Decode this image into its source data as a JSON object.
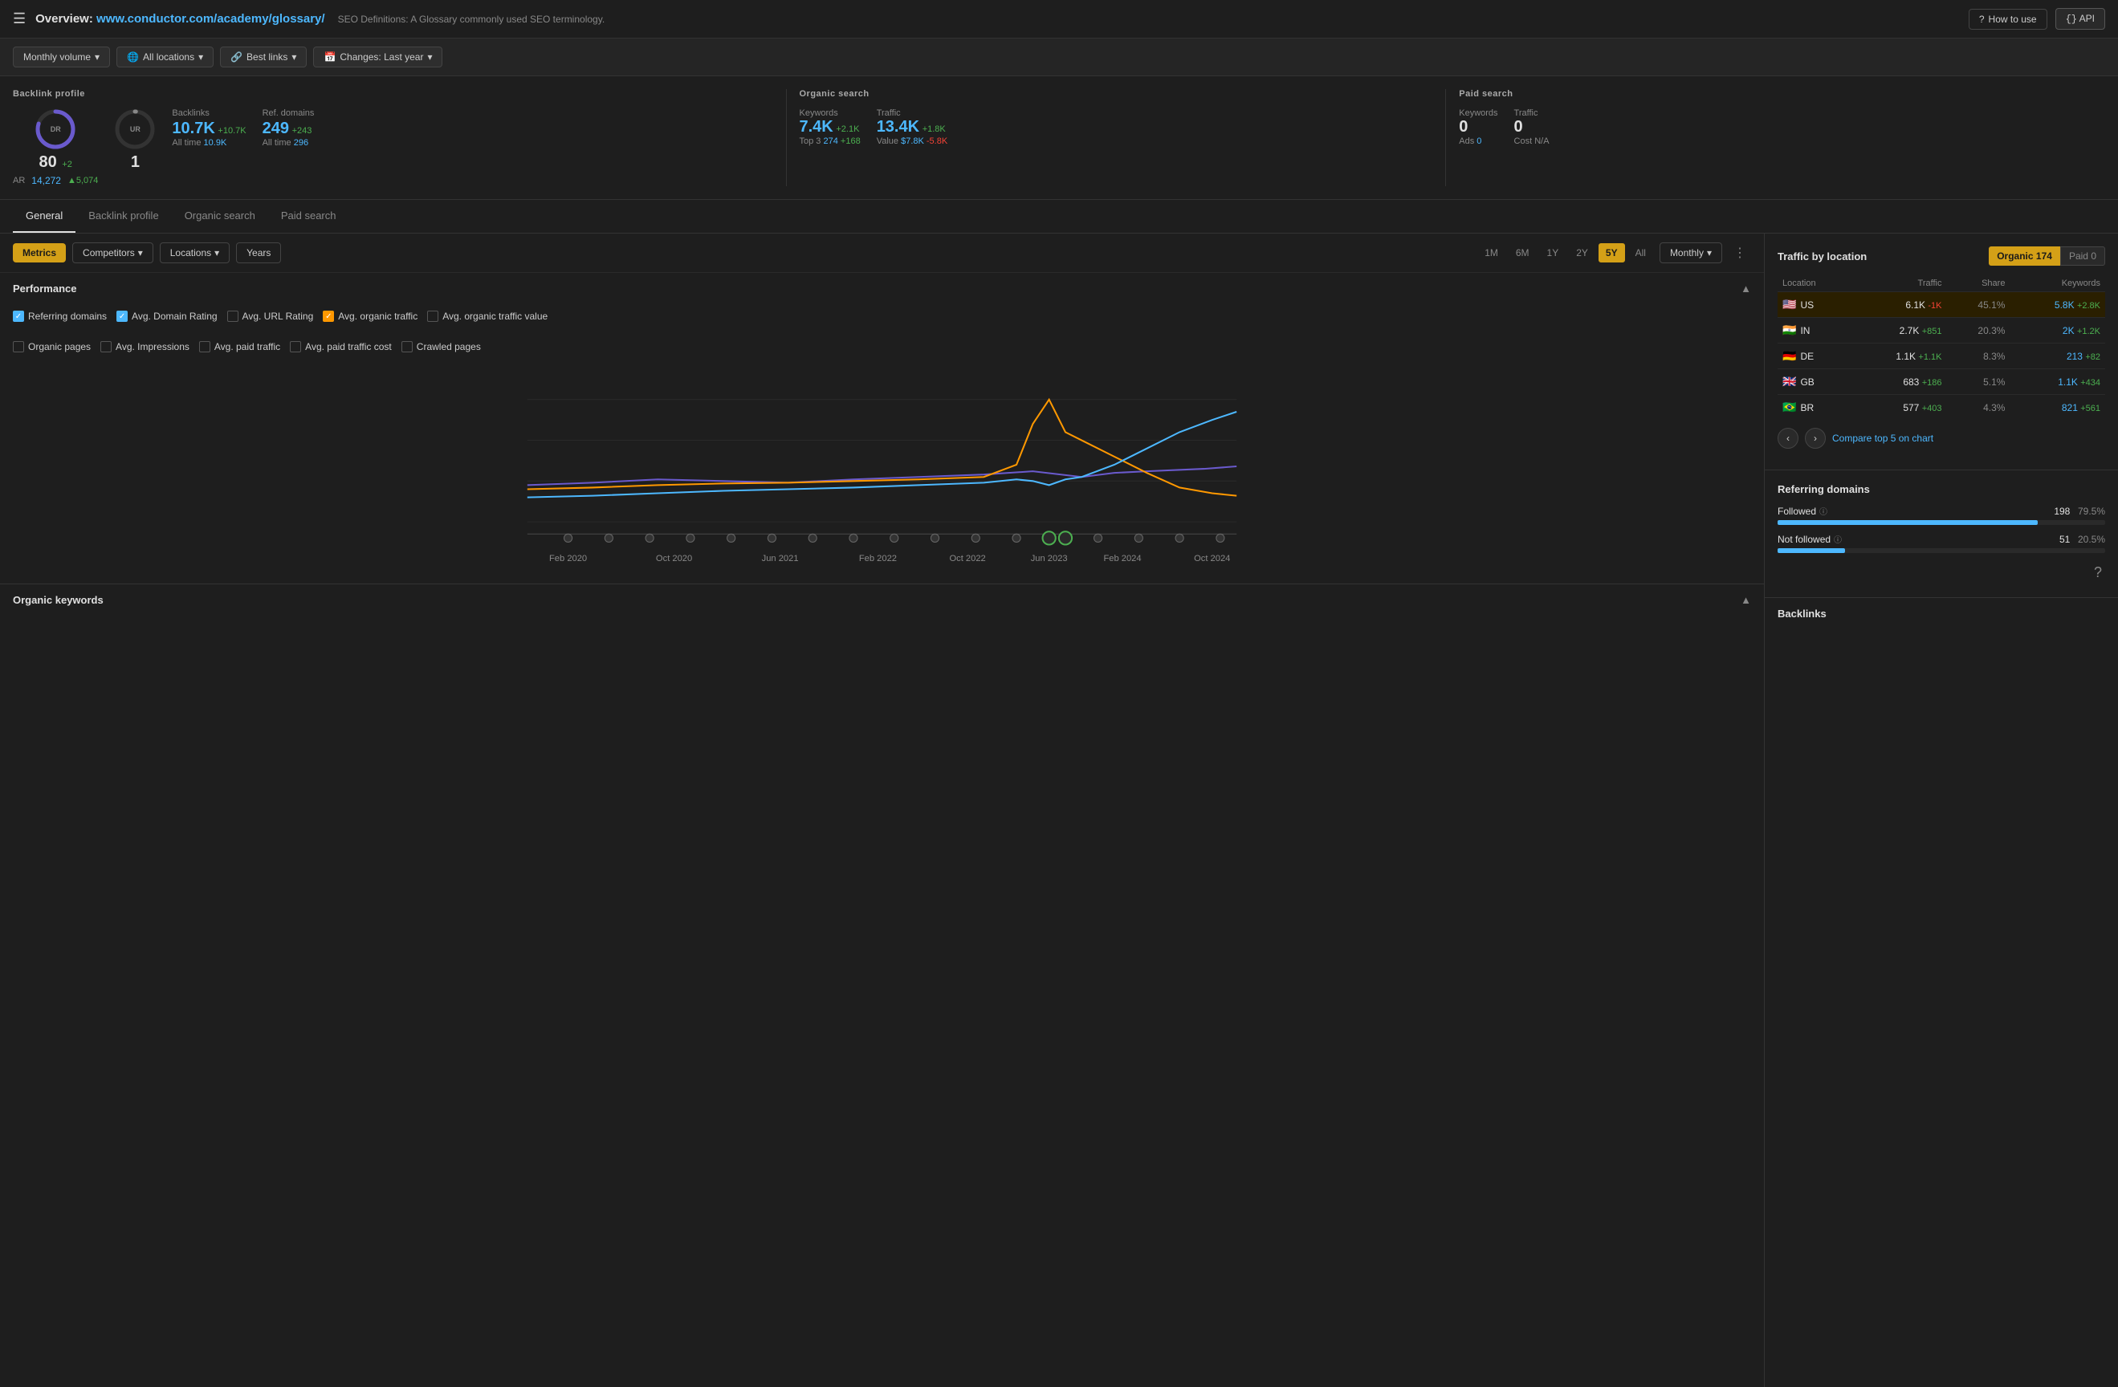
{
  "header": {
    "title": "Overview:",
    "url": "www.conductor.com/academy/glossary/",
    "subtitle": "SEO Definitions: A Glossary commonly used SEO terminology.",
    "how_to_use": "How to use",
    "api": "API",
    "menu_icon": "☰"
  },
  "toolbar": {
    "monthly_volume": "Monthly volume",
    "all_locations": "All locations",
    "best_links": "Best links",
    "changes": "Changes: Last year"
  },
  "backlink_profile": {
    "title": "Backlink profile",
    "dr_label": "DR",
    "dr_value": "80",
    "dr_change": "+2",
    "ar_label": "AR",
    "ar_value": "14,272",
    "ar_change": "▲5,074",
    "ur_label": "UR",
    "ur_value": "1",
    "backlinks_label": "Backlinks",
    "backlinks_value": "10.7K",
    "backlinks_change": "+10.7K",
    "backlinks_alltime_label": "All time",
    "backlinks_alltime": "10.9K",
    "ref_domains_label": "Ref. domains",
    "ref_domains_value": "249",
    "ref_domains_change": "+243",
    "ref_domains_alltime_label": "All time",
    "ref_domains_alltime": "296"
  },
  "organic_search": {
    "title": "Organic search",
    "keywords_label": "Keywords",
    "keywords_value": "7.4K",
    "keywords_change": "+2.1K",
    "keywords_top3_label": "Top 3",
    "keywords_top3": "274",
    "keywords_top3_change": "+168",
    "traffic_label": "Traffic",
    "traffic_value": "13.4K",
    "traffic_change": "+1.8K",
    "traffic_value_label": "Value",
    "traffic_value_amount": "$7.8K",
    "traffic_value_change": "-5.8K"
  },
  "paid_search": {
    "title": "Paid search",
    "keywords_label": "Keywords",
    "keywords_value": "0",
    "ads_label": "Ads",
    "ads_value": "0",
    "traffic_label": "Traffic",
    "traffic_value": "0",
    "cost_label": "Cost",
    "cost_value": "N/A"
  },
  "tabs": {
    "items": [
      "General",
      "Backlink profile",
      "Organic search",
      "Paid search"
    ],
    "active": "General"
  },
  "chart_toolbar": {
    "metrics_label": "Metrics",
    "competitors_label": "Competitors",
    "locations_label": "Locations",
    "years_label": "Years",
    "time_periods": [
      "1M",
      "6M",
      "1Y",
      "2Y",
      "5Y",
      "All"
    ],
    "active_period": "5Y",
    "monthly_label": "Monthly"
  },
  "performance": {
    "title": "Performance",
    "checkboxes": [
      {
        "label": "Referring domains",
        "checked": true,
        "color": "blue"
      },
      {
        "label": "Avg. Domain Rating",
        "checked": true,
        "color": "blue"
      },
      {
        "label": "Avg. URL Rating",
        "checked": false,
        "color": "none"
      },
      {
        "label": "Avg. organic traffic",
        "checked": true,
        "color": "orange"
      },
      {
        "label": "Avg. organic traffic value",
        "checked": false,
        "color": "none"
      },
      {
        "label": "Organic pages",
        "checked": false,
        "color": "none"
      },
      {
        "label": "Avg. Impressions",
        "checked": false,
        "color": "none"
      },
      {
        "label": "Avg. paid traffic",
        "checked": false,
        "color": "none"
      },
      {
        "label": "Avg. paid traffic cost",
        "checked": false,
        "color": "none"
      },
      {
        "label": "Crawled pages",
        "checked": false,
        "color": "none"
      }
    ],
    "x_labels": [
      "Feb 2020",
      "Oct 2020",
      "Jun 2021",
      "Feb 2022",
      "Oct 2022",
      "Jun 2023",
      "Feb 2024",
      "Oct 2024"
    ]
  },
  "organic_keywords": {
    "title": "Organic keywords"
  },
  "traffic_by_location": {
    "title": "Traffic by location",
    "organic_label": "Organic",
    "organic_value": "174",
    "paid_label": "Paid",
    "paid_value": "0",
    "columns": [
      "Location",
      "Traffic",
      "Share",
      "Keywords"
    ],
    "rows": [
      {
        "flag": "🇺🇸",
        "country": "US",
        "traffic": "6.1K",
        "traffic_change": "-1K",
        "traffic_neg": true,
        "share": "45.1%",
        "keywords": "5.8K",
        "kw_change": "+2.8K"
      },
      {
        "flag": "🇮🇳",
        "country": "IN",
        "traffic": "2.7K",
        "traffic_change": "+851",
        "traffic_neg": false,
        "share": "20.3%",
        "keywords": "2K",
        "kw_change": "+1.2K"
      },
      {
        "flag": "🇩🇪",
        "country": "DE",
        "traffic": "1.1K",
        "traffic_change": "+1.1K",
        "traffic_neg": false,
        "share": "8.3%",
        "keywords": "213",
        "kw_change": "+82"
      },
      {
        "flag": "🇬🇧",
        "country": "GB",
        "traffic": "683",
        "traffic_change": "+186",
        "traffic_neg": false,
        "share": "5.1%",
        "keywords": "1.1K",
        "kw_change": "+434"
      },
      {
        "flag": "🇧🇷",
        "country": "BR",
        "traffic": "577",
        "traffic_change": "+403",
        "traffic_neg": false,
        "share": "4.3%",
        "keywords": "821",
        "kw_change": "+561"
      }
    ],
    "compare_label": "Compare top 5 on chart"
  },
  "referring_domains": {
    "title": "Referring domains",
    "followed_label": "Followed",
    "followed_value": "198",
    "followed_pct": "79.5%",
    "followed_bar_pct": 79.5,
    "not_followed_label": "Not followed",
    "not_followed_value": "51",
    "not_followed_pct": "20.5%",
    "not_followed_bar_pct": 20.5
  },
  "backlinks_section": {
    "title": "Backlinks"
  },
  "colors": {
    "accent_gold": "#d4a017",
    "accent_blue": "#4db8ff",
    "accent_orange": "#ff9800",
    "positive": "#4caf50",
    "negative": "#f44336",
    "bg_dark": "#1e1e1e",
    "bg_darker": "#1a1a1a",
    "border": "#333"
  }
}
